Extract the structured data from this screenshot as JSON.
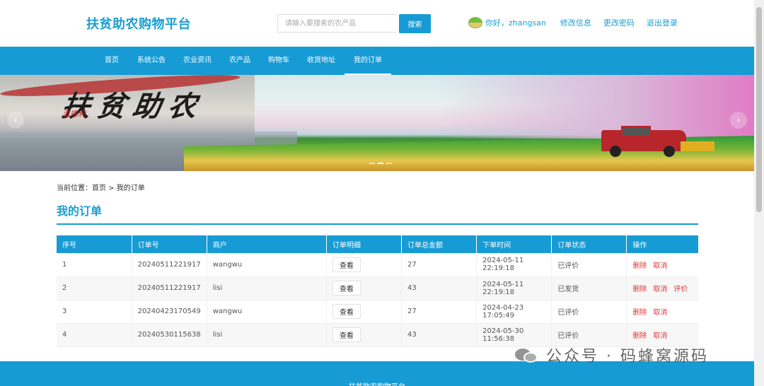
{
  "header": {
    "logo": "扶贫助农购物平台",
    "search_placeholder": "请输入要搜索的农产品",
    "search_button": "搜索",
    "greeting": "你好，zhangsan",
    "links": [
      "修改信息",
      "更改密码",
      "退出登录"
    ]
  },
  "nav": {
    "items": [
      "首页",
      "系统公告",
      "农业资讯",
      "农产品",
      "购物车",
      "收货地址",
      "我的订单"
    ],
    "active": "我的订单"
  },
  "banner": {
    "calligraphy": "扶贫助农",
    "seal": "孟德利",
    "prev_icon": "chevron-left-icon",
    "next_icon": "chevron-right-icon"
  },
  "breadcrumb": "当前位置：首页 > 我的订单",
  "page_title": "我的订单",
  "table": {
    "columns": [
      "序号",
      "订单号",
      "商户",
      "订单明细",
      "订单总金额",
      "下单时间",
      "订单状态",
      "操作"
    ],
    "view_label": "查看",
    "rows": [
      {
        "no": "1",
        "order_id": "20240511221917",
        "merchant": "wangwu",
        "amount": "27",
        "time": "2024-05-11 22:19:18",
        "status": "已评价",
        "ops": [
          "删除",
          "取消"
        ]
      },
      {
        "no": "2",
        "order_id": "20240511221917",
        "merchant": "lisi",
        "amount": "43",
        "time": "2024-05-11 22:19:18",
        "status": "已发货",
        "ops": [
          "删除",
          "取消",
          "评价"
        ]
      },
      {
        "no": "3",
        "order_id": "20240423170549",
        "merchant": "wangwu",
        "amount": "27",
        "time": "2024-04-23 17:05:49",
        "status": "已评价",
        "ops": [
          "删除",
          "取消"
        ]
      },
      {
        "no": "4",
        "order_id": "20240530115638",
        "merchant": "lisi",
        "amount": "43",
        "time": "2024-05-30 11:56:38",
        "status": "已评价",
        "ops": [
          "删除",
          "取消"
        ]
      }
    ]
  },
  "footer": {
    "text": "扶贫助农购物平台"
  },
  "watermark": "公众号 · 码蜂窝源码",
  "colors": {
    "primary": "#169bd5",
    "danger": "#d9383a",
    "logo": "#1b9fd0"
  }
}
